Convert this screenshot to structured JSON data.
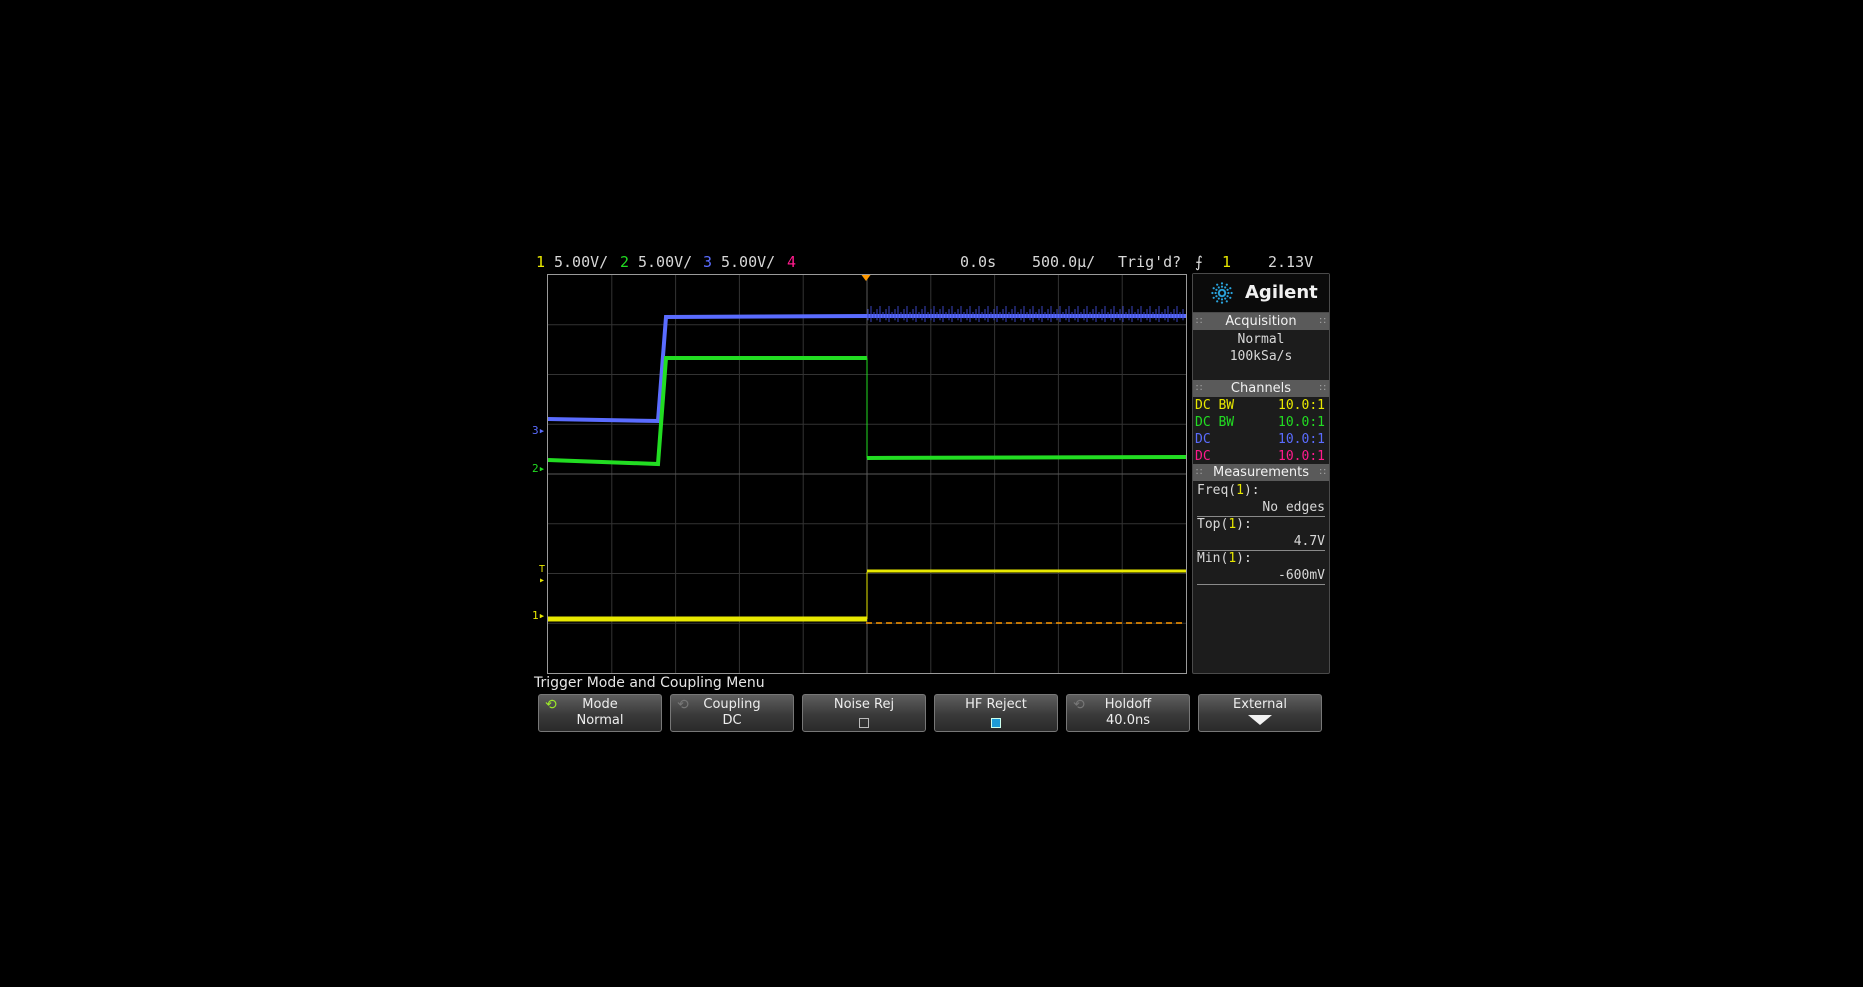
{
  "status_bar": {
    "ch1": {
      "num": "1",
      "scale": "5.00V/",
      "color": "#e8e800"
    },
    "ch2": {
      "num": "2",
      "scale": "5.00V/",
      "color": "#22dd22"
    },
    "ch3": {
      "num": "3",
      "scale": "5.00V/",
      "color": "#5a6cff"
    },
    "ch4": {
      "num": "4",
      "color": "#ff1a8c"
    },
    "time_delay": "0.0s",
    "time_scale": "500.0µ/",
    "trigger_status": "Trig'd?",
    "trigger_source": "1",
    "trigger_level": "2.13V"
  },
  "panel": {
    "brand": "Agilent",
    "acquisition": {
      "header": "Acquisition",
      "mode": "Normal",
      "rate": "100kSa/s"
    },
    "channels": {
      "header": "Channels",
      "rows": [
        {
          "coupling": "DC BW",
          "probe": "10.0:1",
          "color": "#e8e800"
        },
        {
          "coupling": "DC BW",
          "probe": "10.0:1",
          "color": "#22dd22"
        },
        {
          "coupling": "DC",
          "probe": "10.0:1",
          "color": "#5a6cff"
        },
        {
          "coupling": "DC",
          "probe": "10.0:1",
          "color": "#ff1a8c"
        }
      ]
    },
    "measurements": {
      "header": "Measurements",
      "items": [
        {
          "name": "Freq(",
          "ch": "1",
          "close": "):",
          "value": "No edges"
        },
        {
          "name": "Top(",
          "ch": "1",
          "close": "):",
          "value": "4.7V"
        },
        {
          "name": "Min(",
          "ch": "1",
          "close": "):",
          "value": "-600mV"
        }
      ]
    }
  },
  "markers": {
    "ch3": "3",
    "ch2": "2",
    "ch1": "1",
    "trigger": "T"
  },
  "menu": {
    "title": "Trigger Mode and Coupling Menu",
    "softkeys": [
      {
        "label": "Mode",
        "value": "Normal",
        "icon": "cycle-icon"
      },
      {
        "label": "Coupling",
        "value": "DC",
        "icon": "cycle-icon"
      },
      {
        "label": "Noise Rej",
        "checked": false
      },
      {
        "label": "HF Reject",
        "checked": true
      },
      {
        "label": "Holdoff",
        "value": "40.0ns",
        "icon": "cycle-icon"
      },
      {
        "label": "External",
        "icon": "down-arrow-icon"
      }
    ]
  },
  "colors": {
    "ch1": "#e8e800",
    "ch2": "#22dd22",
    "ch3": "#5a6cff",
    "ch4": "#ff1a8c",
    "trigger_level": "#ff9900"
  }
}
